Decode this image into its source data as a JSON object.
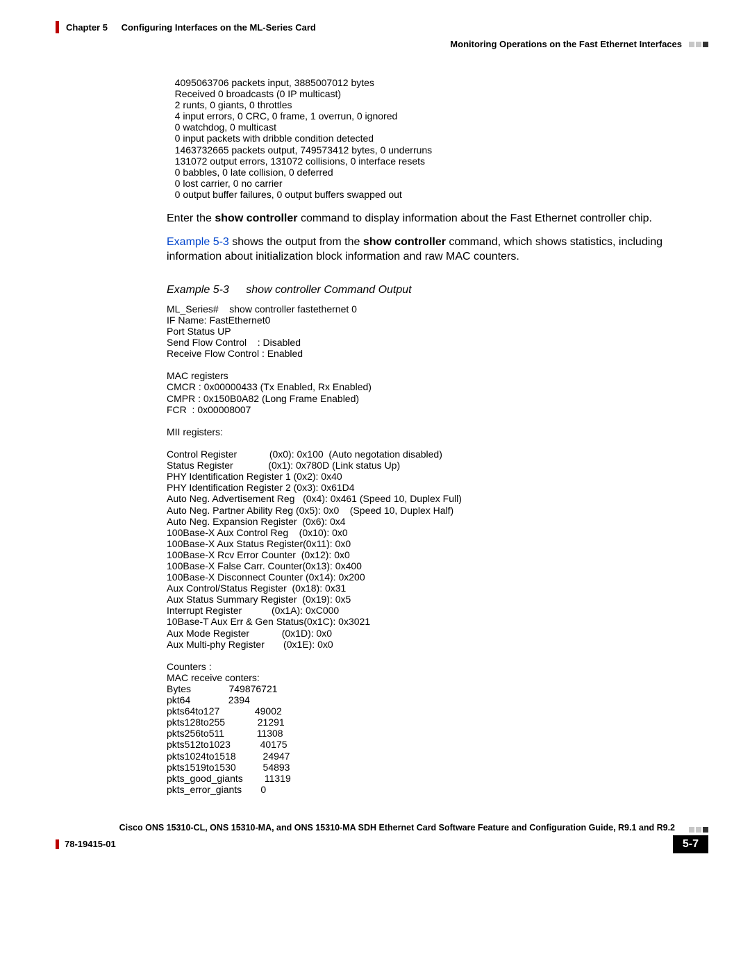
{
  "header": {
    "chapter_label": "Chapter 5",
    "chapter_title": "Configuring Interfaces on the ML-Series Card",
    "section_right": "Monitoring Operations on the Fast Ethernet Interfaces"
  },
  "code_block_1": "   4095063706 packets input, 3885007012 bytes\n   Received 0 broadcasts (0 IP multicast)\n   2 runts, 0 giants, 0 throttles\n   4 input errors, 0 CRC, 0 frame, 1 overrun, 0 ignored\n   0 watchdog, 0 multicast\n   0 input packets with dribble condition detected\n   1463732665 packets output, 749573412 bytes, 0 underruns\n   131072 output errors, 131072 collisions, 0 interface resets\n   0 babbles, 0 late collision, 0 deferred\n   0 lost carrier, 0 no carrier\n   0 output buffer failures, 0 output buffers swapped out",
  "paragraph_1": {
    "t1": "Enter the ",
    "cmd1": "show controller",
    "t2": " command to display information about the Fast Ethernet controller chip."
  },
  "paragraph_2": {
    "link": "Example 5-3",
    "t1": " shows the output from the ",
    "cmd1": "show controller",
    "t2": " command, which shows statistics, including information about initialization block information and raw MAC counters."
  },
  "example_caption": {
    "num": "Example 5-3",
    "title": "show controller Command Output"
  },
  "code_block_2": "ML_Series#    show controller fastethernet 0\nIF Name: FastEthernet0 \nPort Status UP\nSend Flow Control    : Disabled\nReceive Flow Control : Enabled\n\nMAC registers\nCMCR : 0x00000433 (Tx Enabled, Rx Enabled)\nCMPR : 0x150B0A82 (Long Frame Enabled)\nFCR  : 0x00008007 \n\nMII registers:\n\nControl Register            (0x0): 0x100  (Auto negotation disabled)\nStatus Register             (0x1): 0x780D (Link status Up)\nPHY Identification Register 1 (0x2): 0x40 \nPHY Identification Register 2 (0x3): 0x61D4\nAuto Neg. Advertisement Reg   (0x4): 0x461 (Speed 10, Duplex Full)\nAuto Neg. Partner Ability Reg (0x5): 0x0    (Speed 10, Duplex Half)\nAuto Neg. Expansion Register  (0x6): 0x4 \n100Base-X Aux Control Reg    (0x10): 0x0 \n100Base-X Aux Status Register(0x11): 0x0 \n100Base-X Rcv Error Counter  (0x12): 0x0 \n100Base-X False Carr. Counter(0x13): 0x400 \n100Base-X Disconnect Counter (0x14): 0x200 \nAux Control/Status Register  (0x18): 0x31 \nAux Status Summary Register  (0x19): 0x5 \nInterrupt Register           (0x1A): 0xC000 \n10Base-T Aux Err & Gen Status(0x1C): 0x3021\nAux Mode Register            (0x1D): 0x0 \nAux Multi-phy Register       (0x1E): 0x0 \n\nCounters : \nMAC receive conters:\nBytes              749876721\npkt64              2394\npkts64to127             49002\npkts128to255            21291\npkts256to511            11308\npkts512to1023           40175\npkts1024to1518          24947\npkts1519to1530          54893\npkts_good_giants        11319\npkts_error_giants       0",
  "footer": {
    "book_title": "Cisco ONS 15310-CL, ONS 15310-MA, and ONS 15310-MA SDH Ethernet Card Software Feature and Configuration Guide, R9.1 and R9.2",
    "doc_num": "78-19415-01",
    "page_num": "5-7"
  }
}
